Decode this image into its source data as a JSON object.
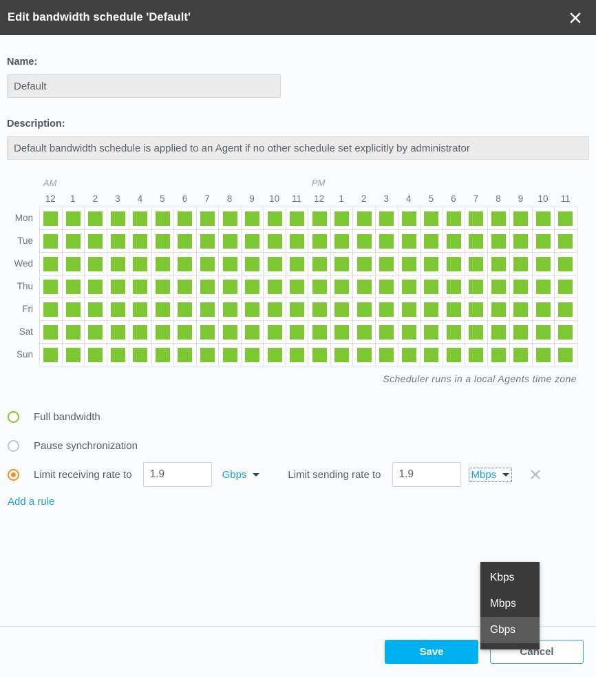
{
  "dialog": {
    "title": "Edit bandwidth schedule 'Default'",
    "close_icon": "close-icon"
  },
  "form": {
    "name_label": "Name:",
    "name_value": "Default",
    "description_label": "Description:",
    "description_value": "Default bandwidth schedule is applied to an Agent if no other schedule set explicitly by administrator"
  },
  "schedule": {
    "am_label": "AM",
    "pm_label": "PM",
    "hours": [
      "12",
      "1",
      "2",
      "3",
      "4",
      "5",
      "6",
      "7",
      "8",
      "9",
      "10",
      "11",
      "12",
      "1",
      "2",
      "3",
      "4",
      "5",
      "6",
      "7",
      "8",
      "9",
      "10",
      "11"
    ],
    "days": [
      "Mon",
      "Tue",
      "Wed",
      "Thu",
      "Fri",
      "Sat",
      "Sun"
    ],
    "timezone_note": "Scheduler runs in a local Agents time zone",
    "active_color": "#7dc832",
    "cells": [
      [
        1,
        1,
        1,
        1,
        1,
        1,
        1,
        1,
        1,
        1,
        1,
        1,
        1,
        1,
        1,
        1,
        1,
        1,
        1,
        1,
        1,
        1,
        1,
        1
      ],
      [
        1,
        1,
        1,
        1,
        1,
        1,
        1,
        1,
        1,
        1,
        1,
        1,
        1,
        1,
        1,
        1,
        1,
        1,
        1,
        1,
        1,
        1,
        1,
        1
      ],
      [
        1,
        1,
        1,
        1,
        1,
        1,
        1,
        1,
        1,
        1,
        1,
        1,
        1,
        1,
        1,
        1,
        1,
        1,
        1,
        1,
        1,
        1,
        1,
        1
      ],
      [
        1,
        1,
        1,
        1,
        1,
        1,
        1,
        1,
        1,
        1,
        1,
        1,
        1,
        1,
        1,
        1,
        1,
        1,
        1,
        1,
        1,
        1,
        1,
        1
      ],
      [
        1,
        1,
        1,
        1,
        1,
        1,
        1,
        1,
        1,
        1,
        1,
        1,
        1,
        1,
        1,
        1,
        1,
        1,
        1,
        1,
        1,
        1,
        1,
        1
      ],
      [
        1,
        1,
        1,
        1,
        1,
        1,
        1,
        1,
        1,
        1,
        1,
        1,
        1,
        1,
        1,
        1,
        1,
        1,
        1,
        1,
        1,
        1,
        1,
        1
      ],
      [
        1,
        1,
        1,
        1,
        1,
        1,
        1,
        1,
        1,
        1,
        1,
        1,
        1,
        1,
        1,
        1,
        1,
        1,
        1,
        1,
        1,
        1,
        1,
        1
      ]
    ]
  },
  "rules": {
    "full_bandwidth_label": "Full bandwidth",
    "pause_label": "Pause synchronization",
    "limit_receiving_label": "Limit receiving rate to",
    "limit_receiving_value": "1.9",
    "limit_receiving_unit": "Gbps",
    "limit_sending_label": "Limit sending rate to",
    "limit_sending_value": "1.9",
    "limit_sending_unit": "Mbps",
    "add_rule_label": "Add a rule",
    "selected_radio_color": "#f5921e",
    "full_bandwidth_radio_color": "#7dc832"
  },
  "unit_dropdown": {
    "options": [
      "Kbps",
      "Mbps",
      "Gbps"
    ],
    "highlighted": "Gbps"
  },
  "footer": {
    "save_label": "Save",
    "cancel_label": "Cancel",
    "save_color": "#00b0f0"
  }
}
